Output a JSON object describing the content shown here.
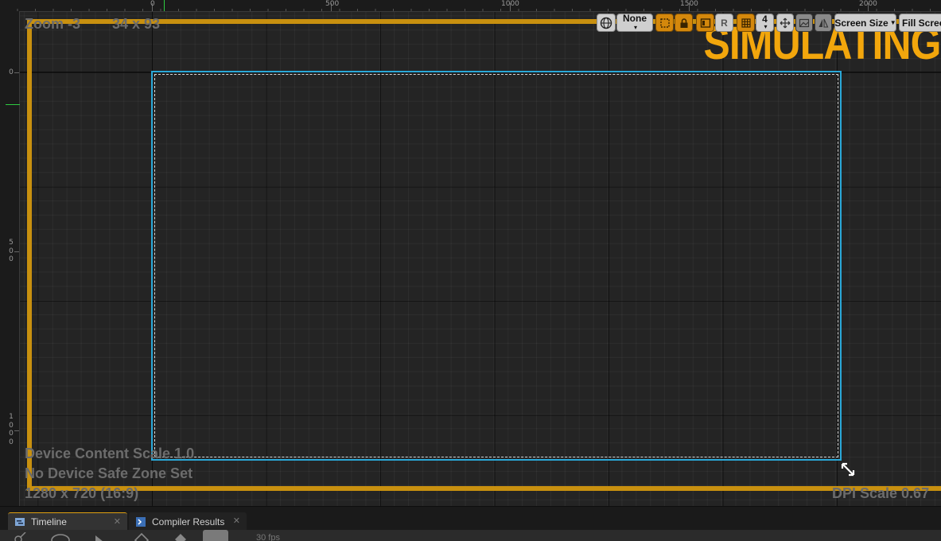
{
  "rulers": {
    "top_labels": [
      "0",
      "500",
      "1000",
      "1500",
      "2000"
    ],
    "left_labels": [
      "0",
      "500",
      "1000"
    ]
  },
  "viewport": {
    "zoom_label": "Zoom -3",
    "size_label": "34 x 93",
    "simulating_label": "SIMULATING",
    "device_content_scale": "Device Content Scale 1.0",
    "safe_zone": "No Device Safe Zone Set",
    "resolution": "1280 x 720 (16:9)",
    "dpi_scale": "DPI Scale 0.67",
    "border_color": "#c8900f",
    "selection_color": "#2aa8d8",
    "simulating_color": "#f2a60c"
  },
  "toolbar": {
    "world_icon": "globe-icon",
    "none_label": "None",
    "r_label": "R",
    "grid_value": "4",
    "screen_size_label": "Screen Size",
    "fill_screen_label": "Fill Screen"
  },
  "tabs": [
    {
      "label": "Timeline",
      "icon": "timeline-icon"
    },
    {
      "label": "Compiler Results",
      "icon": "compiler-icon"
    }
  ],
  "bottom_toolbar": {
    "fps_label": "30 fps"
  }
}
